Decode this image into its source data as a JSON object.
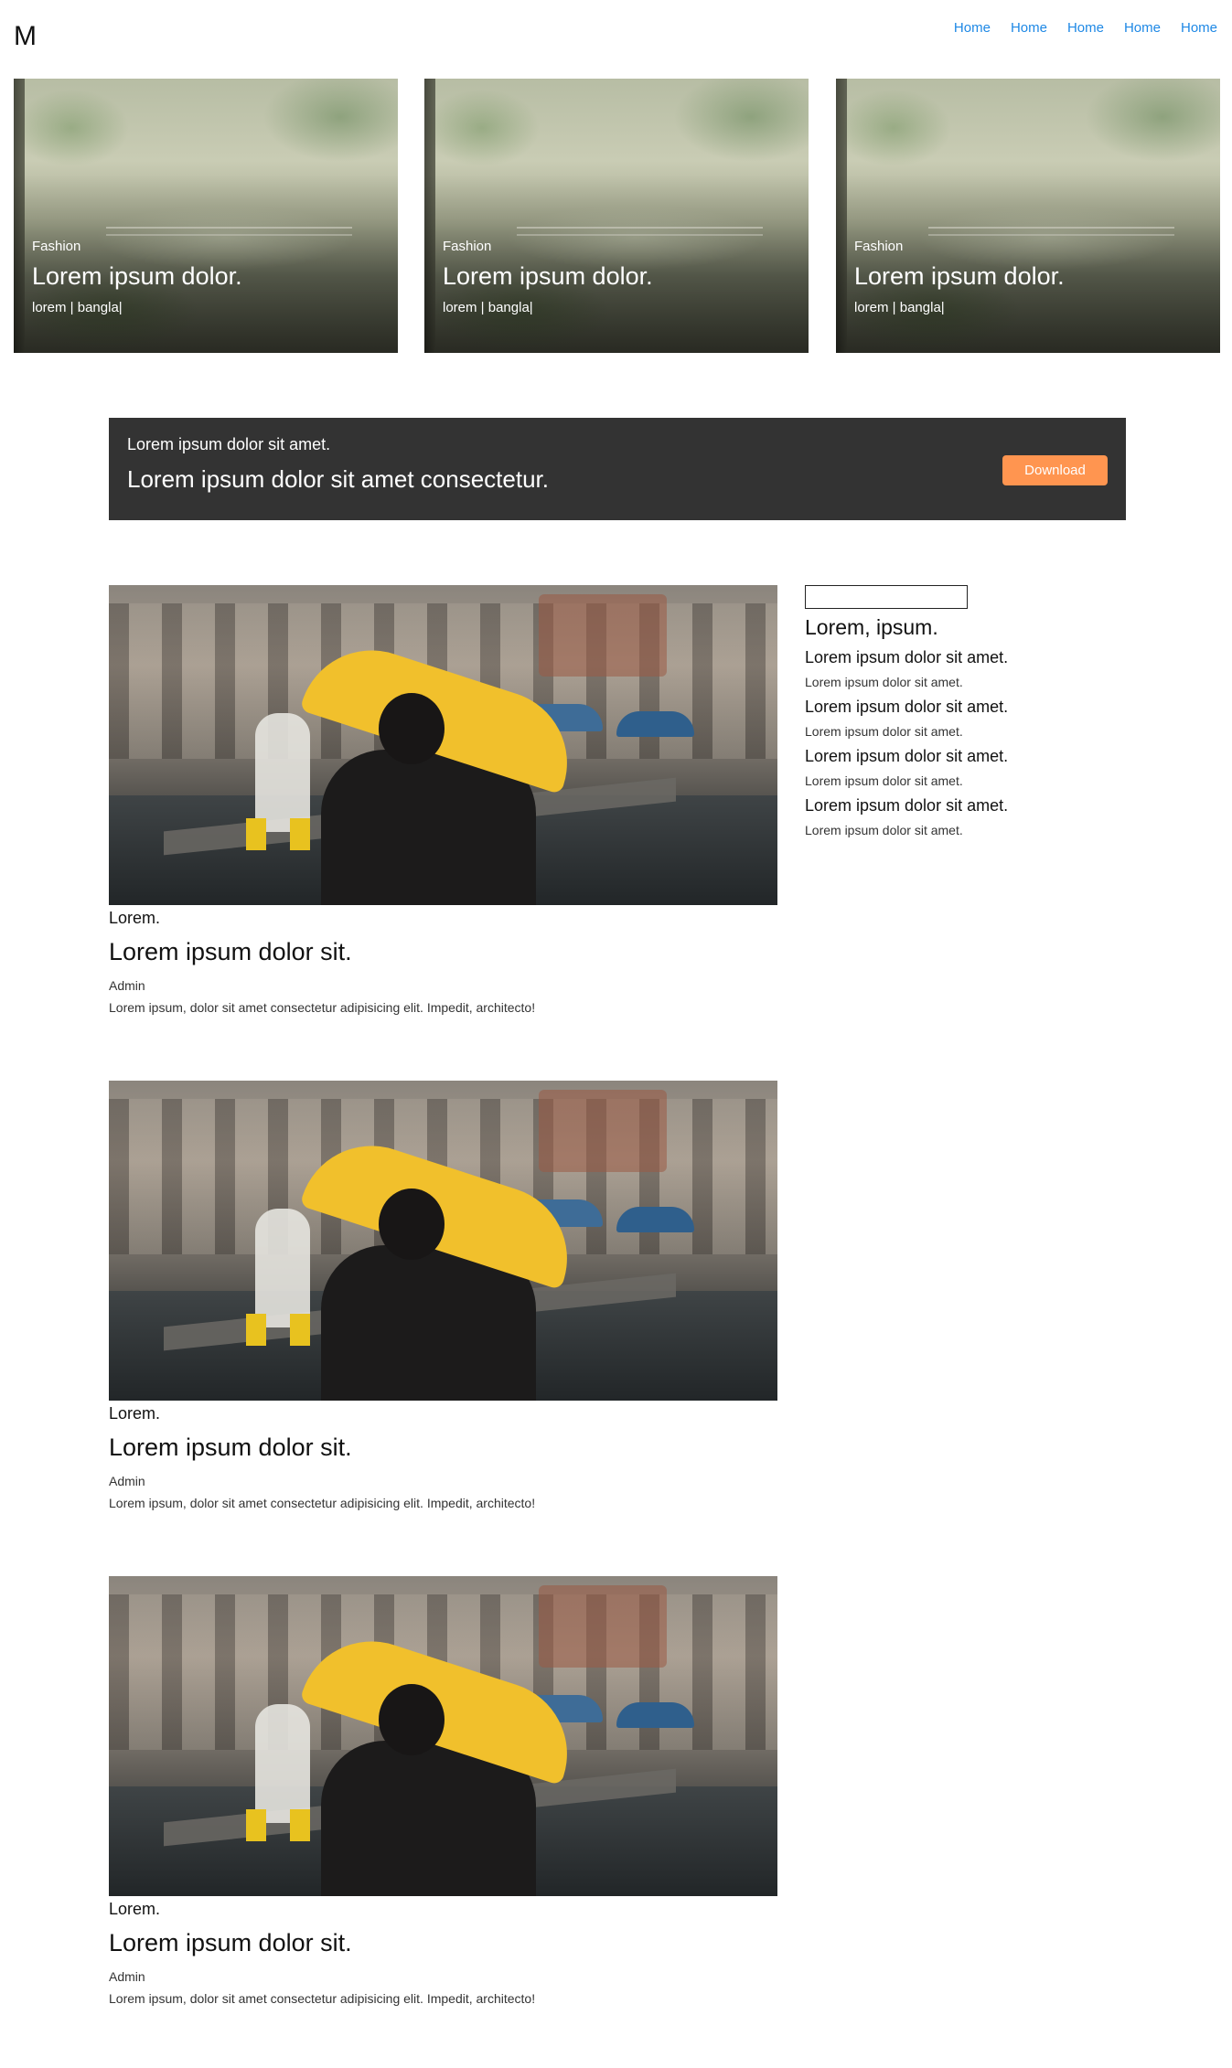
{
  "header": {
    "brand": "M",
    "nav": [
      "Home",
      "Home",
      "Home",
      "Home",
      "Home"
    ]
  },
  "hero_cards": [
    {
      "category": "Fashion",
      "title": "Lorem ipsum dolor.",
      "meta": "lorem | bangla|"
    },
    {
      "category": "Fashion",
      "title": "Lorem ipsum dolor.",
      "meta": "lorem | bangla|"
    },
    {
      "category": "Fashion",
      "title": "Lorem ipsum dolor.",
      "meta": "lorem | bangla|"
    }
  ],
  "banner": {
    "subtitle": "Lorem ipsum dolor sit amet.",
    "title": "Lorem ipsum dolor sit amet consectetur.",
    "button_label": "Download",
    "button_color": "#ff9550",
    "background": "#333333"
  },
  "posts": [
    {
      "category": "Lorem.",
      "title": "Lorem ipsum dolor sit.",
      "author": "Admin",
      "excerpt": "Lorem ipsum, dolor sit amet consectetur adipisicing elit. Impedit, architecto!"
    },
    {
      "category": "Lorem.",
      "title": "Lorem ipsum dolor sit.",
      "author": "Admin",
      "excerpt": "Lorem ipsum, dolor sit amet consectetur adipisicing elit. Impedit, architecto!"
    },
    {
      "category": "Lorem.",
      "title": "Lorem ipsum dolor sit.",
      "author": "Admin",
      "excerpt": "Lorem ipsum, dolor sit amet consectetur adipisicing elit. Impedit, architecto!"
    }
  ],
  "sidebar": {
    "search_value": "",
    "title": "Lorem, ipsum.",
    "items": [
      {
        "heading": "Lorem ipsum dolor sit amet.",
        "text": "Lorem ipsum dolor sit amet."
      },
      {
        "heading": "Lorem ipsum dolor sit amet.",
        "text": "Lorem ipsum dolor sit amet."
      },
      {
        "heading": "Lorem ipsum dolor sit amet.",
        "text": "Lorem ipsum dolor sit amet."
      },
      {
        "heading": "Lorem ipsum dolor sit amet.",
        "text": "Lorem ipsum dolor sit amet."
      }
    ]
  }
}
